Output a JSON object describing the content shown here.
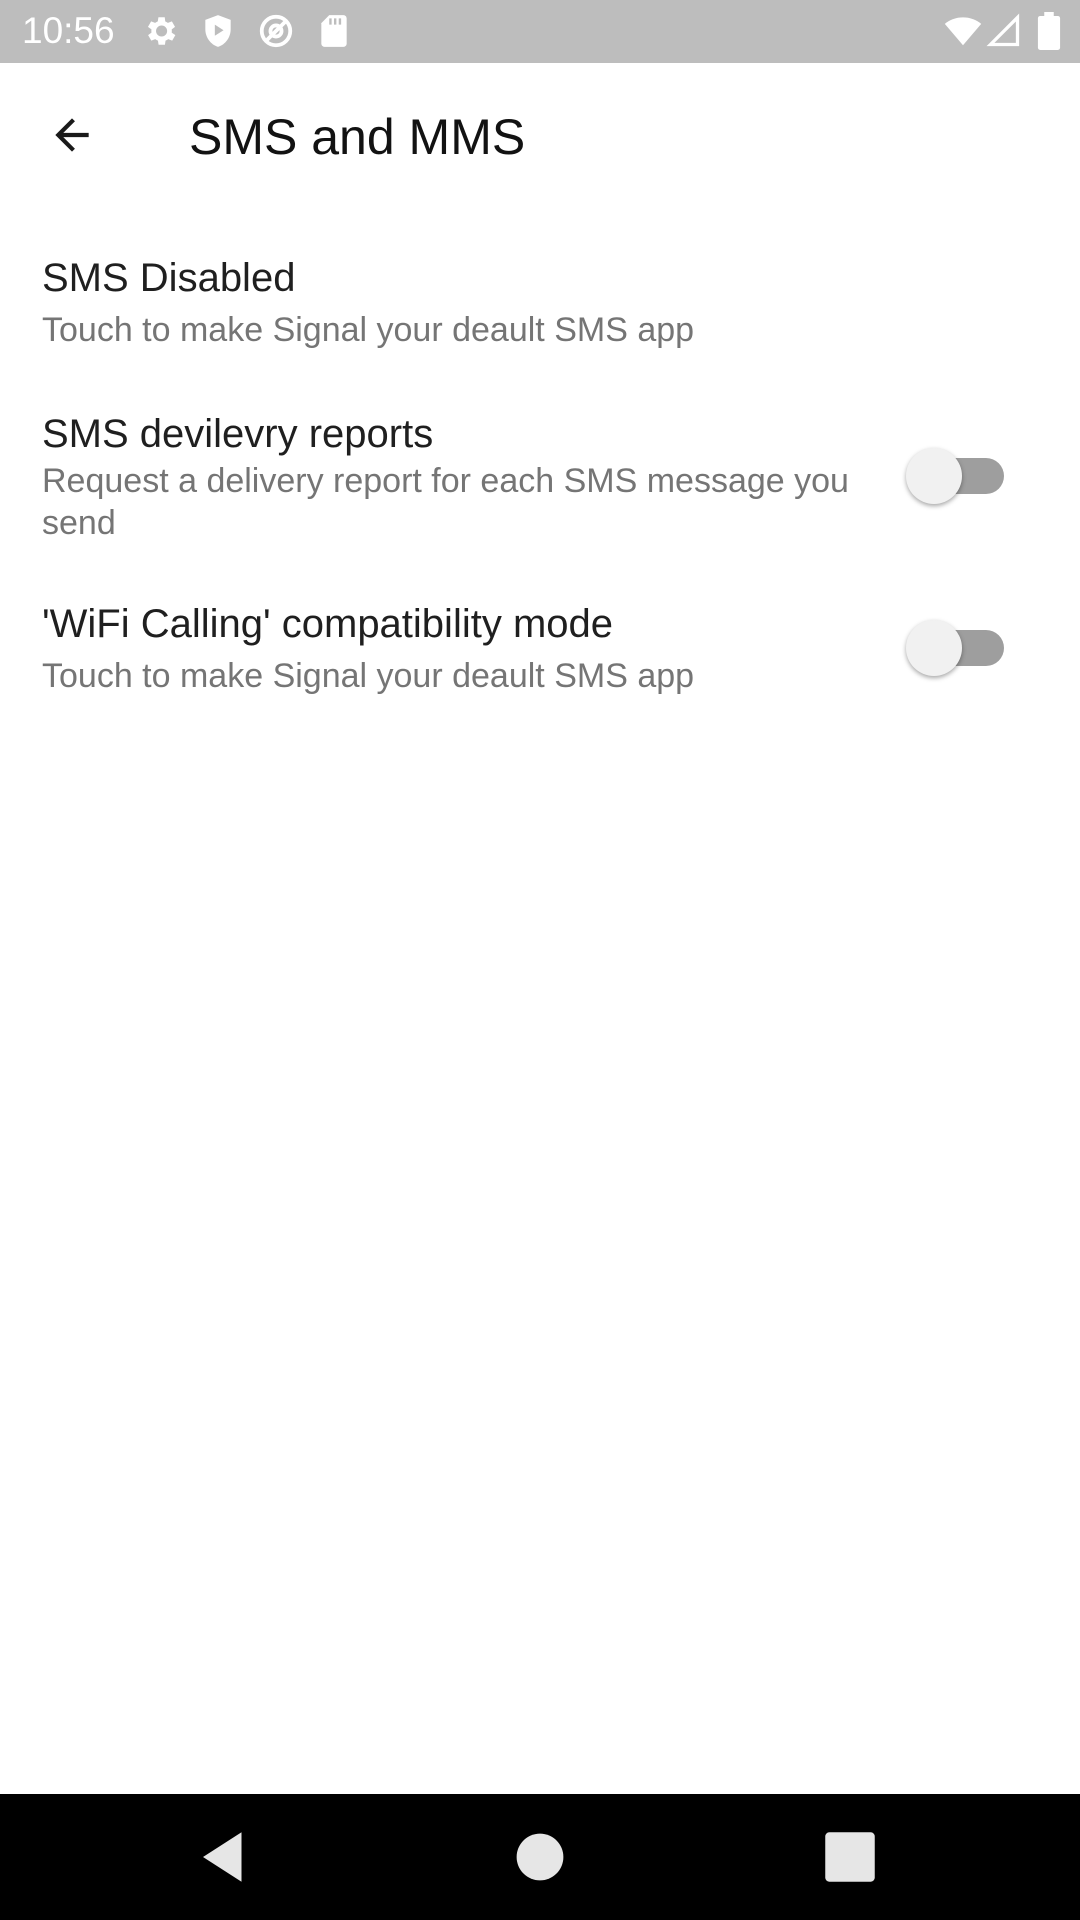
{
  "status_bar": {
    "time": "10:56",
    "icons": [
      "settings-icon",
      "shield-play-icon",
      "at-sign-icon",
      "sd-card-icon",
      "wifi-icon",
      "signal-icon",
      "battery-icon"
    ]
  },
  "app_bar": {
    "title": "SMS and MMS",
    "back_icon": "arrow-back-icon"
  },
  "preferences": [
    {
      "title": "SMS Disabled",
      "summary": "Touch to make Signal your deault SMS app"
    },
    {
      "title": "SMS devilevry reports",
      "summary": "Request a delivery report for each SMS message you send",
      "toggle_on": false
    },
    {
      "title": "'WiFi Calling' compatibility mode",
      "summary": "Touch to make Signal your deault SMS app",
      "toggle_on": false
    }
  ],
  "nav_bar": {
    "icons": [
      "nav-back-icon",
      "nav-home-icon",
      "nav-recents-icon"
    ]
  },
  "colors": {
    "status_bar": "#bdbdbd",
    "title": "#121212",
    "summary": "#757575",
    "switch_track": "#9e9e9e",
    "switch_thumb": "#f1f1f1",
    "nav_bar": "#000000"
  }
}
